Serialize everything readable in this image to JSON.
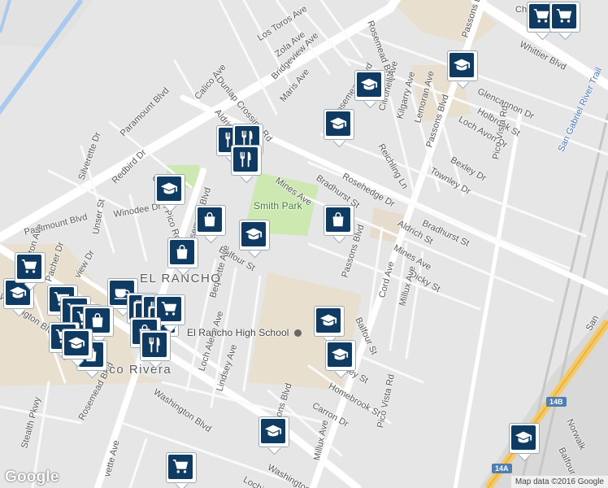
{
  "map": {
    "attribution": "Map data ©2016 Google",
    "logo": "Google",
    "park": "Smith Park",
    "neighborhood": "EL RANCHO",
    "city": "Pico Rivera",
    "school": "El Rancho High School",
    "school_icon": "school-icon",
    "highway_shields": [
      "14B",
      "14A"
    ],
    "freeway_label": "San",
    "streets": {
      "los_toros": "Los Toros Ave",
      "zola": "Zola Ave",
      "bridgeview": "Bridgeview Ave",
      "maris": "Maris Ave",
      "dunlap": "Dunlap Crossing Rd",
      "calico": "Calico Ave",
      "aldrich_nw": "Aldrich",
      "paramount_top": "Paramount Blvd",
      "paramount_left": "Paramount Blvd",
      "silverette": "Silverette Dr",
      "redbird": "Redbird Dr",
      "coffman": "Coffman Pico Rd",
      "winodee": "Winodee Dr",
      "unser": "Unser St",
      "rosemead_top": "Rosemead Blvd",
      "rosemead_mid": "Rosemead Blvd",
      "rosemead_bot": "Rosemead Blvd",
      "mines_left": "Mines Ave",
      "mines_right": "Mines Ave",
      "balfour_left": "Balfour St",
      "balfour_right": "Balfour St",
      "bequette": "Bequette Ave",
      "phaeton": "Phaeton Ave",
      "pacher": "Pacher Dr",
      "view_dr": "view Dr",
      "washington_left": "Washington Blvd",
      "washington_mid": "Washington Blvd",
      "washington_bot": "Washington Blvd",
      "loch_alene": "Loch Alene Ave",
      "lindsey": "Lindsey Ave",
      "stealth": "Stealth Pkwy",
      "vette": "vette Ave",
      "lochi": "Lochi",
      "passons_top": "Passons Blvd",
      "passons_mid": "Passons Blvd",
      "passons_low": "Passons Blvd",
      "passons_bot": "Passons Blvd",
      "citronell": "Citronell Ave",
      "kilgarry": "Kilgarry Ave",
      "lemoran": "Lemoran Ave",
      "reichling": "Reichling Ln",
      "rosehedge": "Rosehedge Dr",
      "bradhurst_left": "Bradhurst St",
      "bradhurst_right": "Bradhurst St",
      "aldrich": "Aldrich St",
      "glencannon": "Glencannon Dr",
      "holbrook": "Holbrook St",
      "loch_avon": "Loch Avon Dr",
      "bexley": "Bexley Dr",
      "townley": "Townley Dr",
      "pico_vista_top": "Pico Vista Rd",
      "pico_vista_bot": "Pico Vista Rd",
      "san_gabriel": "San Gabriel River Trail",
      "whittier": "Whittier Blvd",
      "dicky": "Dicky St",
      "cord": "Cord Ave",
      "millux_top": "Millux Ave",
      "millux_bot": "Millux Ave",
      "haney": "Haney St",
      "homebrook": "Homebrook St",
      "carron": "Carron Dr",
      "norwalk": "Norwalk",
      "balfour_se": "Balfour S",
      "rosemead_n": "Rosemead Blvd",
      "ch": "Ch"
    },
    "pins": [
      {
        "icon": "cart-icon"
      },
      {
        "icon": "cart-icon"
      },
      {
        "icon": "school-icon"
      },
      {
        "icon": "school-icon"
      },
      {
        "icon": "school-icon"
      },
      {
        "icon": "shopping-bag-icon"
      },
      {
        "icon": "restaurant-icon"
      },
      {
        "icon": "restaurant-icon"
      },
      {
        "icon": "restaurant-icon"
      },
      {
        "icon": "school-icon"
      },
      {
        "icon": "shopping-bag-icon"
      },
      {
        "icon": "school-icon"
      },
      {
        "icon": "shopping-bag-icon"
      },
      {
        "icon": "school-icon"
      },
      {
        "icon": "cart-icon"
      },
      {
        "icon": "cart-icon"
      },
      {
        "icon": "coffee-icon"
      },
      {
        "icon": "cart-icon"
      },
      {
        "icon": "cart-icon"
      },
      {
        "icon": "shopping-bag-icon"
      },
      {
        "icon": "restaurant-icon"
      },
      {
        "icon": "restaurant-icon"
      },
      {
        "icon": "restaurant-icon"
      },
      {
        "icon": "cart-icon"
      },
      {
        "icon": "cart-icon"
      },
      {
        "icon": "shopping-bag-icon"
      },
      {
        "icon": "restaurant-icon"
      },
      {
        "icon": "school-icon"
      },
      {
        "icon": "school-icon"
      },
      {
        "icon": "shopping-bag-icon"
      },
      {
        "icon": "cart-icon"
      },
      {
        "icon": "school-icon"
      },
      {
        "icon": "school-icon"
      },
      {
        "icon": "school-icon"
      },
      {
        "icon": "cart-icon"
      }
    ]
  }
}
